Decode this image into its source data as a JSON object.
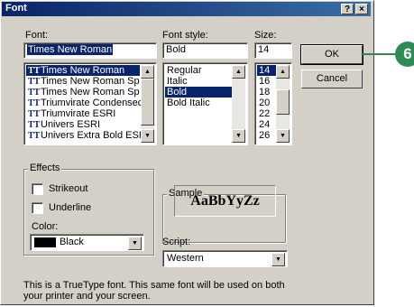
{
  "dialog": {
    "title": "Font",
    "help_label": "?",
    "close_label": "×"
  },
  "font": {
    "label": "Font:",
    "value": "Times New Roman",
    "items": [
      {
        "label": "Times New Roman",
        "selected": true
      },
      {
        "label": "Times New Roman Sp"
      },
      {
        "label": "Times New Roman Sp"
      },
      {
        "label": "Triumvirate Condensec"
      },
      {
        "label": "Triumvirate ESRI"
      },
      {
        "label": "Univers ESRI"
      },
      {
        "label": "Univers Extra Bold ESF"
      }
    ]
  },
  "style": {
    "label": "Font style:",
    "value": "Bold",
    "items": [
      "Regular",
      "Italic",
      "Bold",
      "Bold Italic"
    ]
  },
  "size": {
    "label": "Size:",
    "value": "14",
    "items": [
      "14",
      "16",
      "18",
      "20",
      "22",
      "24",
      "26"
    ]
  },
  "buttons": {
    "ok": "OK",
    "cancel": "Cancel"
  },
  "effects": {
    "title": "Effects",
    "strikeout": "Strikeout",
    "underline": "Underline",
    "color_label": "Color:",
    "color_value": "Black",
    "color_hex": "#000000"
  },
  "sample": {
    "title": "Sample",
    "text": "AaBbYyZz"
  },
  "script": {
    "label": "Script:",
    "value": "Western"
  },
  "description": {
    "line1": "This is a TrueType font. This same font will be used on both",
    "line2": "your printer and your screen."
  },
  "callout": {
    "number": "6",
    "color": "#2e8b57"
  }
}
